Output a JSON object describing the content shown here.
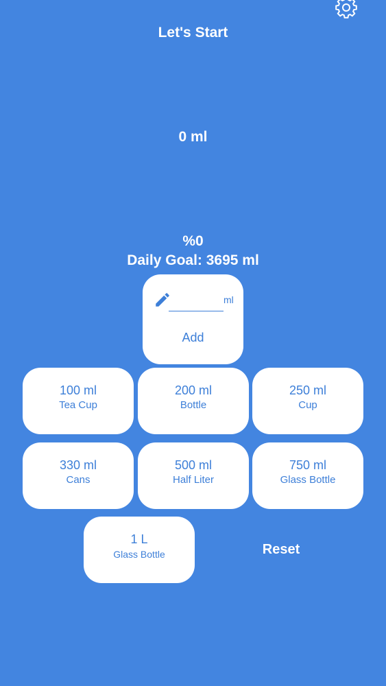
{
  "header": {
    "title": "Let's Start",
    "settings_icon": "gear-icon"
  },
  "progress": {
    "amount": "0 ml",
    "percent": "%0",
    "daily_goal": "Daily Goal: 3695 ml"
  },
  "custom_entry": {
    "icon": "pencil-icon",
    "value": "",
    "unit": "ml",
    "add_label": "Add"
  },
  "drinks": [
    {
      "qty": "100 ml",
      "label": "Tea Cup"
    },
    {
      "qty": "200 ml",
      "label": "Bottle"
    },
    {
      "qty": "250 ml",
      "label": "Cup"
    },
    {
      "qty": "330 ml",
      "label": "Cans"
    },
    {
      "qty": "500 ml",
      "label": "Half Liter"
    },
    {
      "qty": "750 ml",
      "label": "Glass Bottle"
    },
    {
      "qty": "1 L",
      "label": "Glass Bottle"
    }
  ],
  "actions": {
    "reset_label": "Reset"
  },
  "colors": {
    "background": "#4385e0",
    "card": "#ffffff",
    "card_text": "#3d7fd8"
  }
}
